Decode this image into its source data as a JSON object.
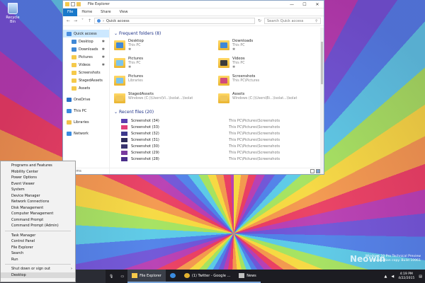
{
  "desktop": {
    "recycle_bin_label": "Recycle Bin",
    "watermark_line1": "Windows 10 Pro Technical Preview",
    "watermark_line2": "Evaluation copy. Build 10061",
    "watermark_logo": "Neowin"
  },
  "explorer": {
    "title": "File Explorer",
    "window_buttons": [
      "—",
      "☐",
      "✕"
    ],
    "ribbon_tabs": [
      "File",
      "Home",
      "Share",
      "View"
    ],
    "address": "Quick access",
    "search_placeholder": "Search Quick access",
    "nav": [
      {
        "label": "Quick access",
        "selected": true,
        "indent": false,
        "color": "#4a8fe0"
      },
      {
        "label": "Desktop",
        "pinned": true,
        "indent": true,
        "color": "#3f88d6"
      },
      {
        "label": "Downloads",
        "pinned": true,
        "indent": true,
        "color": "#3f88d6"
      },
      {
        "label": "Pictures",
        "pinned": true,
        "indent": true,
        "color": "#f5c94a"
      },
      {
        "label": "Videos",
        "pinned": true,
        "indent": true,
        "color": "#f5c94a"
      },
      {
        "label": "Screenshots",
        "indent": true,
        "color": "#f5c94a"
      },
      {
        "label": "StagedAssets",
        "indent": true,
        "color": "#f5c94a"
      },
      {
        "label": "Assets",
        "indent": true,
        "color": "#f5c94a"
      },
      {
        "gap": true
      },
      {
        "label": "OneDrive",
        "indent": false,
        "color": "#2a72c8"
      },
      {
        "gap": true
      },
      {
        "label": "This PC",
        "indent": false,
        "color": "#3b8ce0"
      },
      {
        "gap": true
      },
      {
        "label": "Libraries",
        "indent": false,
        "color": "#f0c14a"
      },
      {
        "gap": true
      },
      {
        "label": "Network",
        "indent": false,
        "color": "#3b8ce0"
      }
    ],
    "frequent_heading": "Frequent folders (8)",
    "frequent": [
      {
        "name": "Desktop",
        "sub": "This PC",
        "glyph": "#3f88d6",
        "pinned": true
      },
      {
        "name": "Downloads",
        "sub": "This PC",
        "glyph": "#3f88d6",
        "pinned": true
      },
      {
        "name": "Pictures",
        "sub": "This PC",
        "glyph": "#7ac4ee",
        "pinned": true
      },
      {
        "name": "Videos",
        "sub": "This PC",
        "glyph": "#3b3b3b",
        "pinned": true
      },
      {
        "name": "Pictures",
        "sub": "Libraries",
        "glyph": "#7ac4ee"
      },
      {
        "name": "Screenshots",
        "sub": "This PC\\Pictures",
        "glyph": "#d14a7b"
      },
      {
        "name": "StagedAssets",
        "sub": "Windows (C:)\\Users\\Vi...\\Isolat...\\Isolat",
        "glyph": "#f0c75a"
      },
      {
        "name": "Assets",
        "sub": "Windows (C:)\\Users\\Bi...\\Isolat...\\Isolat",
        "glyph": "#f0c75a"
      }
    ],
    "recent_heading": "Recent files (20)",
    "recent": [
      {
        "name": "Screenshot (34)",
        "path": "This PC\\Pictures\\Screenshots",
        "thumb": "#5b3fb0"
      },
      {
        "name": "Screenshot (33)",
        "path": "This PC\\Pictures\\Screenshots",
        "thumb": "#e2407a"
      },
      {
        "name": "Screenshot (32)",
        "path": "This PC\\Pictures\\Screenshots",
        "thumb": "#3e3a8e"
      },
      {
        "name": "Screenshot (31)",
        "path": "This PC\\Pictures\\Screenshots",
        "thumb": "#2f2c5c"
      },
      {
        "name": "Screenshot (30)",
        "path": "This PC\\Pictures\\Screenshots",
        "thumb": "#3a3570"
      },
      {
        "name": "Screenshot (29)",
        "path": "This PC\\Pictures\\Screenshots",
        "thumb": "#7a3b9e"
      },
      {
        "name": "Screenshot (28)",
        "path": "This PC\\Pictures\\Screenshots",
        "thumb": "#4b2f8a"
      }
    ],
    "status": "19 items"
  },
  "winx_menu": {
    "groups": [
      [
        "Programs and Features",
        "Mobility Center",
        "Power Options",
        "Event Viewer",
        "System",
        "Device Manager",
        "Network Connections",
        "Disk Management",
        "Computer Management",
        "Command Prompt",
        "Command Prompt (Admin)"
      ],
      [
        "Task Manager",
        "Control Panel",
        "File Explorer",
        "Search",
        "Run"
      ],
      [
        "Shut down or sign out",
        "Desktop"
      ]
    ],
    "submenu_item": "Shut down or sign out",
    "selected_item": "Desktop"
  },
  "taskbar": {
    "apps": [
      {
        "label": "File Explorer",
        "icon": "folder-icon",
        "color": "#f5c94a",
        "active": true
      },
      {
        "label": "",
        "icon": "edge-icon",
        "color": "#3b8ce0",
        "active": false
      },
      {
        "label": "(1) Twitter - Google ...",
        "icon": "chrome-icon",
        "color": "#e3b230",
        "active": false
      },
      {
        "label": "News",
        "icon": "news-icon",
        "color": "#c0c0c0",
        "active": false
      }
    ],
    "time": "4:19 PM",
    "date": "4/22/2015"
  }
}
